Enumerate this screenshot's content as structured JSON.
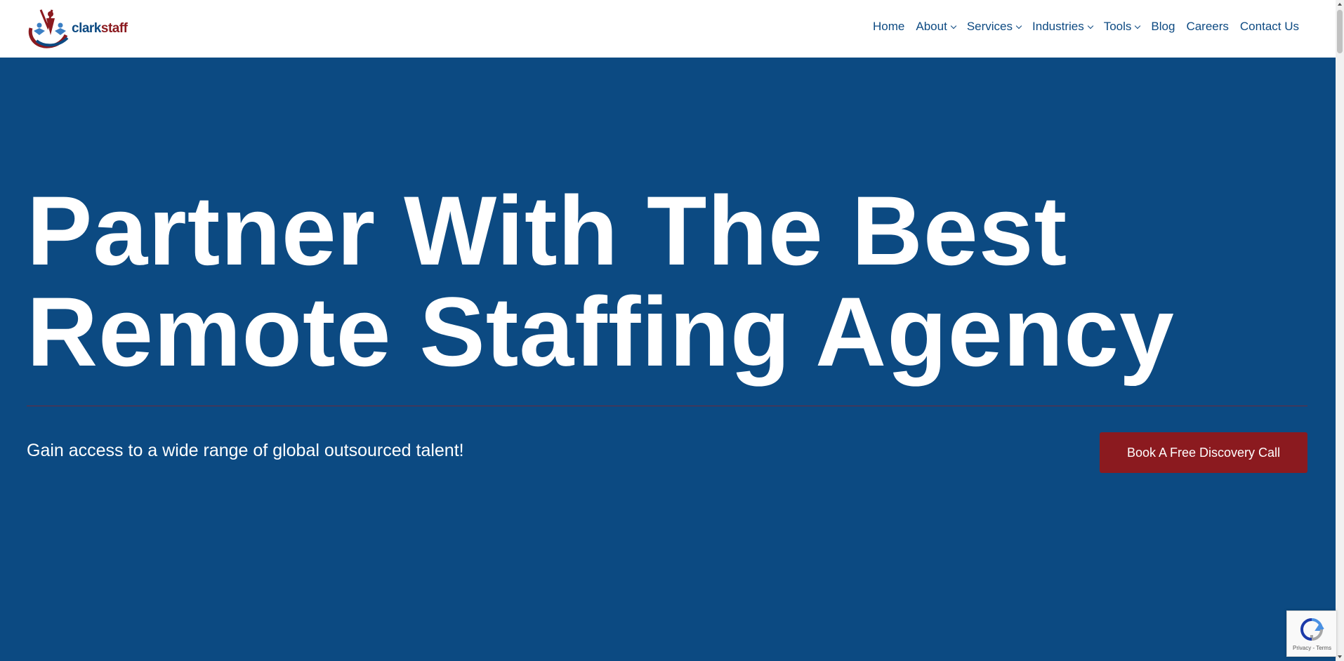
{
  "brand": {
    "name_part1": "clark",
    "name_part2": "staff",
    "colors": {
      "blue": "#0d4a82",
      "red": "#8b1a1f"
    }
  },
  "nav": {
    "items": [
      {
        "label": "Home",
        "has_dropdown": false
      },
      {
        "label": "About",
        "has_dropdown": true
      },
      {
        "label": "Services",
        "has_dropdown": true
      },
      {
        "label": "Industries",
        "has_dropdown": true
      },
      {
        "label": "Tools",
        "has_dropdown": true
      },
      {
        "label": "Blog",
        "has_dropdown": false
      },
      {
        "label": "Careers",
        "has_dropdown": false
      },
      {
        "label": "Contact Us",
        "has_dropdown": false
      }
    ]
  },
  "hero": {
    "title_line1": "Partner With The Best",
    "title_line2": "Remote Staffing Agency",
    "subtitle": "Gain access to a wide range of global outsourced talent!",
    "cta_label": "Book A Free Discovery Call",
    "background_color": "#0c4a82",
    "cta_color": "#8b1a1f"
  },
  "recaptcha": {
    "links": "Privacy - Terms",
    "icon": "recaptcha-icon"
  }
}
